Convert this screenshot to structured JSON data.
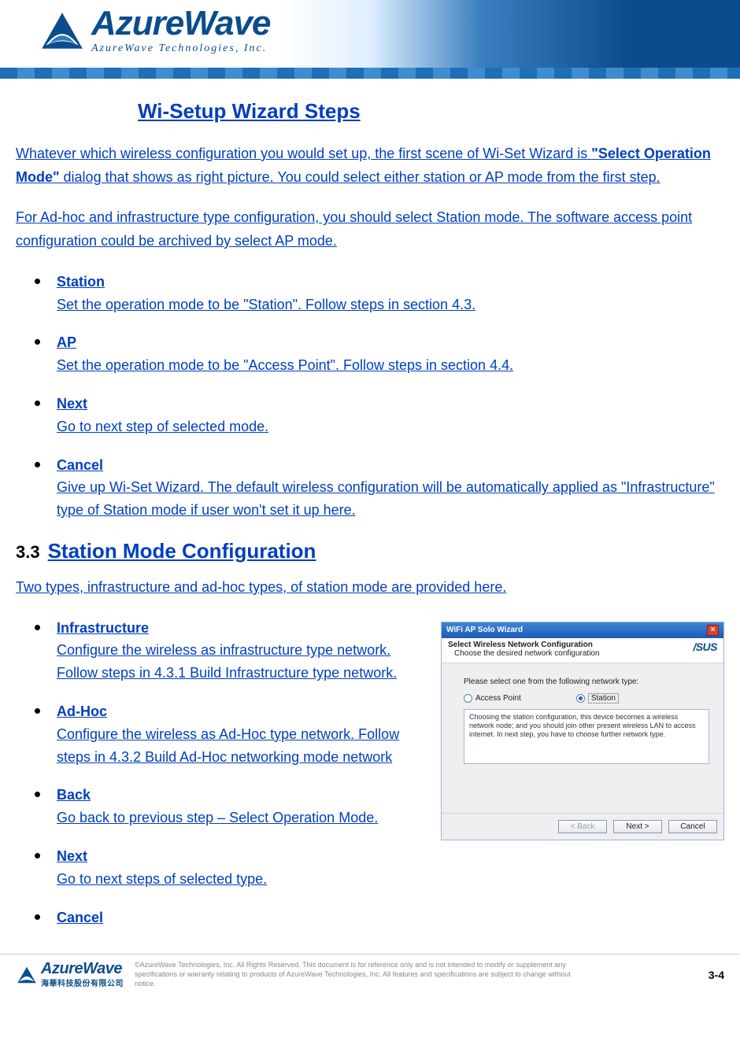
{
  "brand": {
    "name": "AzureWave",
    "tagline": "AzureWave  Technologies,   Inc."
  },
  "section_title": "Wi-Setup Wizard Steps",
  "intro_html": "Whatever which wireless configuration you would set up, the first scene of Wi-Set Wizard is <b>\"Select Operation Mode\"</b> dialog that shows as right picture. You could select either station or AP mode from the first step. ",
  "intro2": "For Ad-hoc and infrastructure type configuration, you should select Station mode. The software access point configuration could be archived by select AP mode.  ",
  "list1": [
    {
      "term": "Station ",
      "desc": "Set the operation mode to be \"Station\". Follow steps in section 4.3."
    },
    {
      "term": "AP",
      "desc": "Set the operation mode to be \"Access Point\". Follow steps in section 4.4."
    },
    {
      "term": "Next",
      "desc": "Go to next step of selected mode."
    },
    {
      "term": "Cancel",
      "desc": "Give up Wi-Set Wizard. The default wireless configuration will be automatically applied as \"Infrastructure\" type of Station mode if user won't set it up here."
    }
  ],
  "sec2": {
    "num": "3.3",
    "title": "Station Mode Configuration",
    "intro": "Two types, infrastructure and ad-hoc types, of station mode are provided here.  ",
    "items": [
      {
        "term": "Infrastructure",
        "desc": "Configure the wireless as infrastructure type network. Follow steps in 4.3.1 Build Infrastructure type network."
      },
      {
        "term": "Ad-Hoc",
        "desc": "Configure the wireless as Ad-Hoc type network. Follow steps in 4.3.2 Build Ad-Hoc networking mode network"
      },
      {
        "term": "Back",
        "desc": "Go back to previous step – Select Operation Mode."
      },
      {
        "term": "Next",
        "desc": "Go to next steps of selected type."
      },
      {
        "term": "Cancel",
        "desc": ""
      }
    ]
  },
  "wizard": {
    "title": "WiFi AP Solo Wizard",
    "brand": "/SUS",
    "heading1": "Select Wireless Network Configuration",
    "heading2": "Choose the desired network configuration",
    "prompt": "Please select one from the following network type:",
    "opt_ap": "Access Point",
    "opt_station": "Station",
    "desc": "Choosing the station configuration, this device becomes a wireless network node; and you should join other present wireless LAN to access internet. In next step, you have to choose further network type.",
    "btn_back": "< Back",
    "btn_next": "Next >",
    "btn_cancel": "Cancel"
  },
  "footer": {
    "brand_big": "AzureWave",
    "brand_cn": "海華科技股份有限公司",
    "legal": "©AzureWave Technologies, Inc. All Rights Reserved. This document is for reference only and is not intended to modify or supplement any specifications or warranty relating to products of AzureWave Technologies, Inc. All features and specifications are subject to change without notice.",
    "page": "3-4"
  }
}
